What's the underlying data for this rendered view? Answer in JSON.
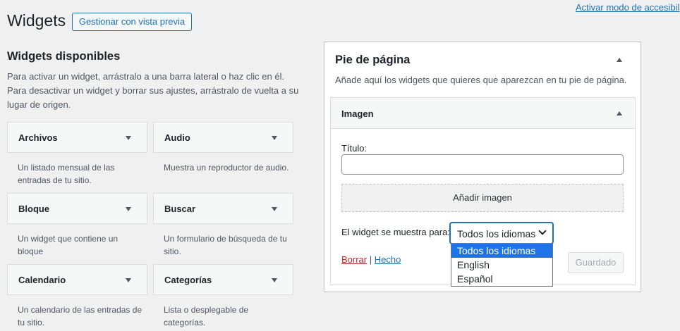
{
  "header": {
    "title": "Widgets",
    "preview_button": "Gestionar con vista previa",
    "accessibility_link": "Activar modo de accesibil"
  },
  "available": {
    "title": "Widgets disponibles",
    "description": "Para activar un widget, arrástralo a una barra lateral o haz clic en él. Para desactivar un widget y borrar sus ajustes, arrástralo de vuelta a su lugar de origen.",
    "widgets": [
      {
        "title": "Archivos",
        "description": "Un listado mensual de las entradas de tu sitio."
      },
      {
        "title": "Audio",
        "description": "Muestra un reproductor de audio."
      },
      {
        "title": "Bloque",
        "description": "Un widget que contiene un bloque"
      },
      {
        "title": "Buscar",
        "description": "Un formulario de búsqueda de tu sitio."
      },
      {
        "title": "Calendario",
        "description": "Un calendario de las entradas de tu sitio."
      },
      {
        "title": "Categorías",
        "description": "Lista o desplegable de categorías."
      }
    ]
  },
  "sidebar": {
    "title": "Pie de página",
    "description": "Añade aquí los widgets que quieres que aparezcan en tu pie de página.",
    "widget": {
      "title": "Imagen",
      "title_label": "Título:",
      "title_value": "",
      "add_image_button": "Añadir imagen",
      "visibility_label": "El widget se muestra para:",
      "visibility_selected": "Todos los idiomas",
      "visibility_options": [
        "Todos los idiomas",
        "English",
        "Español"
      ],
      "delete_link": "Borrar",
      "separator": "|",
      "done_link": "Hecho",
      "saved_button": "Guardado"
    }
  },
  "colors": {
    "accent": "#2271b1",
    "delete": "#b32d2e",
    "option_highlight": "#1e73e8"
  }
}
